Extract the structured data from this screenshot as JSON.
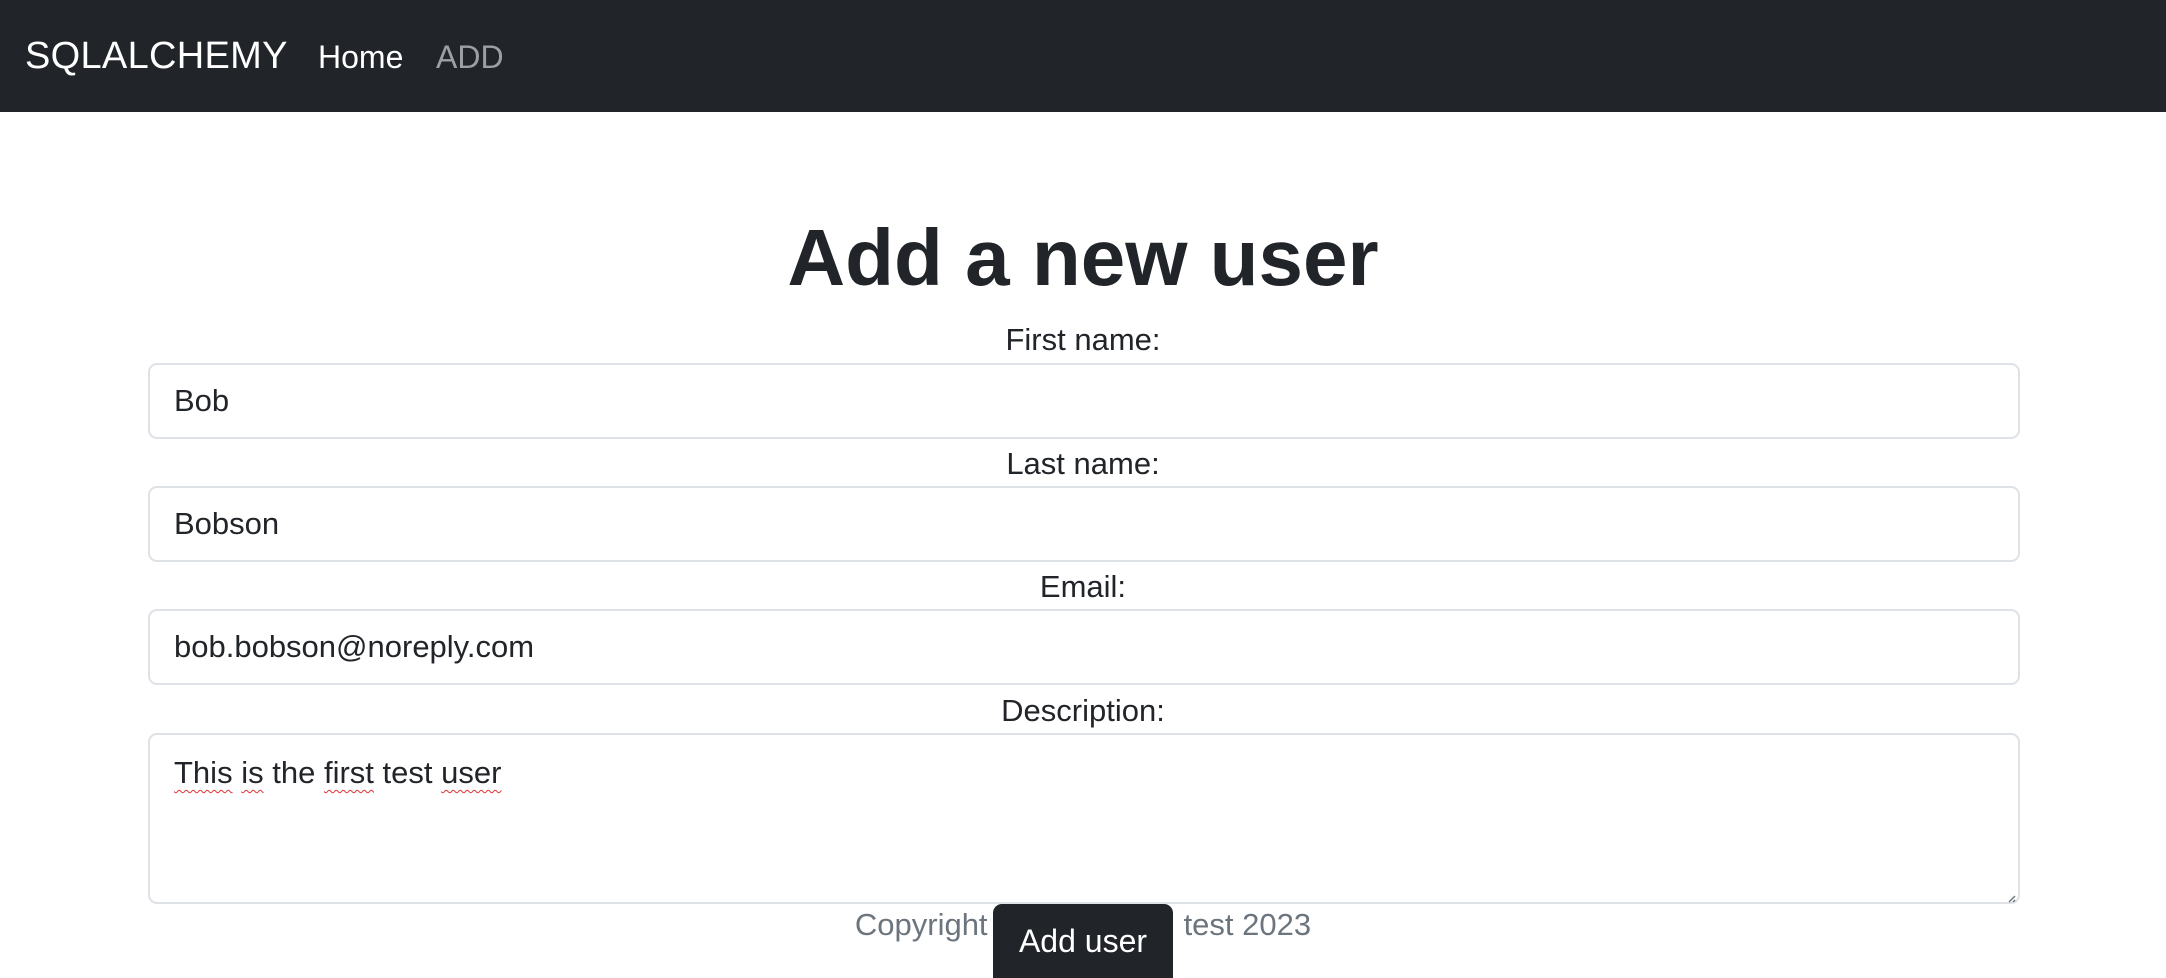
{
  "navbar": {
    "brand": "SQLALCHEMY",
    "links": [
      {
        "label": "Home",
        "active": true
      },
      {
        "label": "ADD",
        "active": false
      }
    ]
  },
  "main": {
    "title": "Add a new user",
    "fields": {
      "first_name": {
        "label": "First name:",
        "value": "Bob"
      },
      "last_name": {
        "label": "Last name:",
        "value": "Bobson"
      },
      "email": {
        "label": "Email:",
        "value": "bob.bobson@noreply.com"
      },
      "description": {
        "label": "Description:",
        "words": [
          {
            "text": "This",
            "misspelled": true
          },
          {
            "text": "is",
            "misspelled": true
          },
          {
            "text": "the",
            "misspelled": false
          },
          {
            "text": "first",
            "misspelled": true
          },
          {
            "text": "test",
            "misspelled": false
          },
          {
            "text": "user",
            "misspelled": true
          }
        ]
      }
    },
    "submit_label": "Add user"
  },
  "footer": {
    "left": "Copyright",
    "right": "test 2023"
  },
  "colors": {
    "navbar_bg": "#212529",
    "nav_active": "#ffffff",
    "nav_inactive": "#9ca0a4",
    "button_bg": "#212529",
    "spellcheck_underline": "#e03131"
  }
}
